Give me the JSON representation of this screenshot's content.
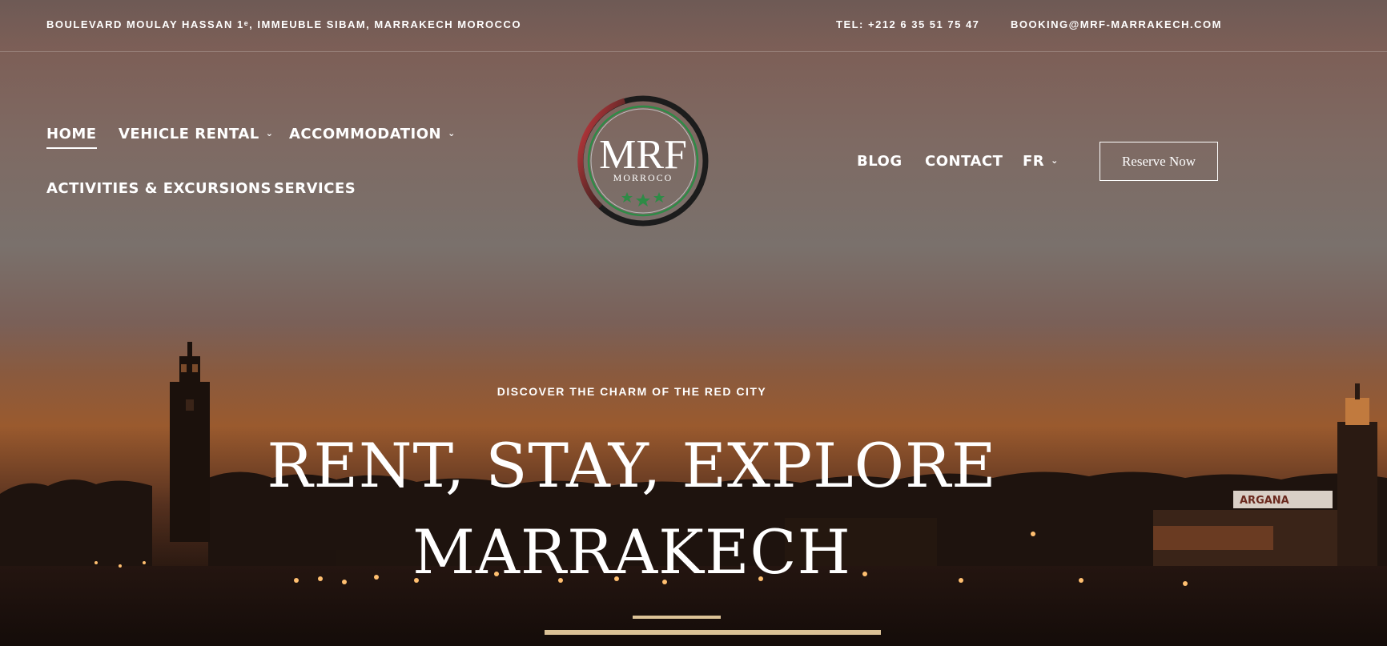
{
  "topbar": {
    "address": "BOULEVARD MOULAY HASSAN 1ᵉ, IMMEUBLE SIBAM, MARRAKECH MOROCCO",
    "phone": "TEL: +212 6 35 51 75 47",
    "email": "BOOKING@MRF-MARRAKECH.COM"
  },
  "nav": {
    "home": "HOME",
    "vehicle_rental": "VEHICLE RENTAL",
    "accommodation": "ACCOMMODATION",
    "activities": "ACTIVITIES & EXCURSIONS",
    "services": "SERVICES",
    "blog": "BLOG",
    "contact": "CONTACT",
    "language": "FR",
    "reserve": "Reserve Now"
  },
  "logo": {
    "text": "MRF",
    "subtext": "MORROCO"
  },
  "hero": {
    "kicker": "DISCOVER THE CHARM OF THE RED CITY",
    "title_line1": "RENT, STAY, EXPLORE",
    "title_line2": "MARRAKECH"
  },
  "skyline": {
    "sign": "ARGANA"
  },
  "colors": {
    "logo_red": "#c0333a",
    "logo_green": "#2e8b46",
    "logo_dark": "#1c1c1c"
  }
}
